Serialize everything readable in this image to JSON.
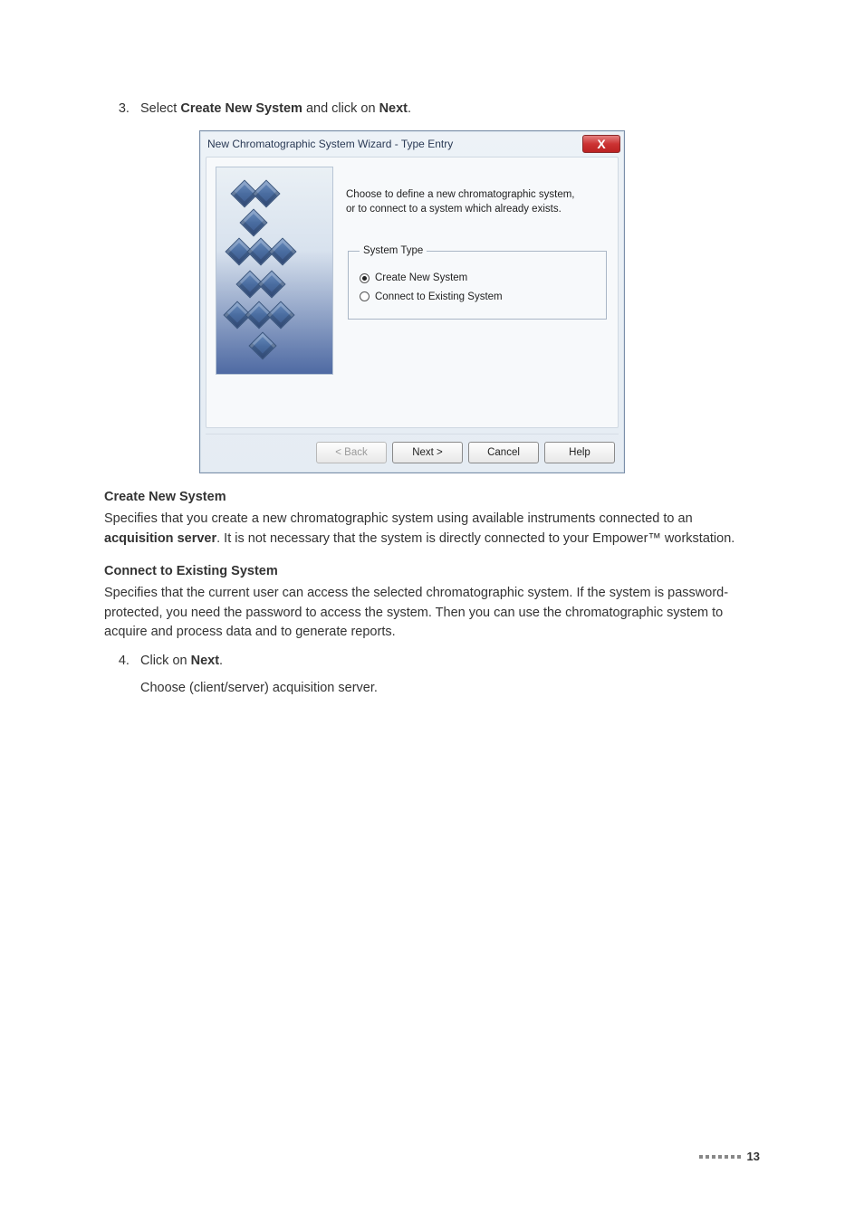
{
  "step3": {
    "prefix": "Select ",
    "bold1": "Create New System",
    "mid": " and click on ",
    "bold2": "Next",
    "suffix": "."
  },
  "dialog": {
    "title": "New Chromatographic System Wizard - Type Entry",
    "close_glyph": "X",
    "instruction_line1": "Choose to define a new chromatographic system,",
    "instruction_line2": "or to connect to a system which already exists.",
    "group_label": "System Type",
    "radio_create": "Create New System",
    "radio_connect": "Connect to Existing System",
    "btn_back": "< Back",
    "btn_next": "Next >",
    "btn_cancel": "Cancel",
    "btn_help": "Help"
  },
  "heading_create": "Create New System",
  "para_create_1": "Specifies that you create a new chromatographic system using available instruments connected to an ",
  "para_create_bold": "acquisition server",
  "para_create_2": ". It is not necessary that the system is directly connected to your Empower™ workstation.",
  "heading_connect": "Connect to Existing System",
  "para_connect": "Specifies that the current user can access the selected chromatographic system. If the system is password-protected, you need the password to access the system. Then you can use the chromatographic system to acquire and process data and to generate reports.",
  "step4": {
    "prefix": "Click on ",
    "bold": "Next",
    "suffix": ".",
    "sub": "Choose (client/server) acquisition server."
  },
  "page_number": "13"
}
